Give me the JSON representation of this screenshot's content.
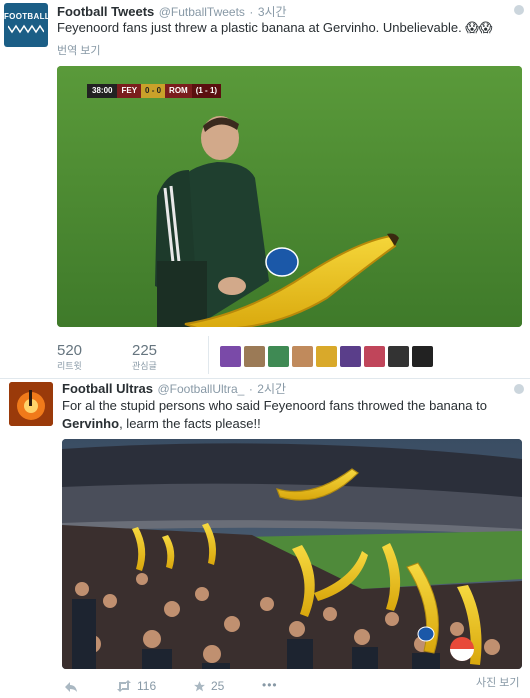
{
  "tweet1": {
    "avatar_text": "FOOTBALL",
    "name": "Football Tweets",
    "handle": "@FutballTweets",
    "sep": "·",
    "time": "3시간",
    "text": "Feyenoord fans just threw a plastic banana at Gervinho. Unbelievable. 😱😱",
    "translate": "번역 보기",
    "scoreboard": {
      "clock": "38:00",
      "home": "FEY",
      "score": "0 - 0",
      "away": "ROM",
      "agg": "(1 - 1)"
    },
    "stats": [
      {
        "value": "520",
        "label": "리트윗"
      },
      {
        "value": "225",
        "label": "관심글"
      }
    ],
    "favoriter_colors": [
      "#7a4aa8",
      "#9b7a56",
      "#3f8a54",
      "#c08a5c",
      "#d9a92a",
      "#5a3e8a",
      "#c0455a",
      "#333333",
      "#222222"
    ]
  },
  "tweet2": {
    "name": "Football Ultras",
    "handle": "@FootballUltra_",
    "sep": "·",
    "time": "2시간",
    "text_1": "For al the stupid persons who said Feyenoord fans throwed the banana to ",
    "text_bold": "Gervinho",
    "text_2": ", learm the facts please!!",
    "photo_link": "사진 보기",
    "actions": {
      "retweets": "116",
      "likes": "25",
      "more": "•••"
    }
  }
}
